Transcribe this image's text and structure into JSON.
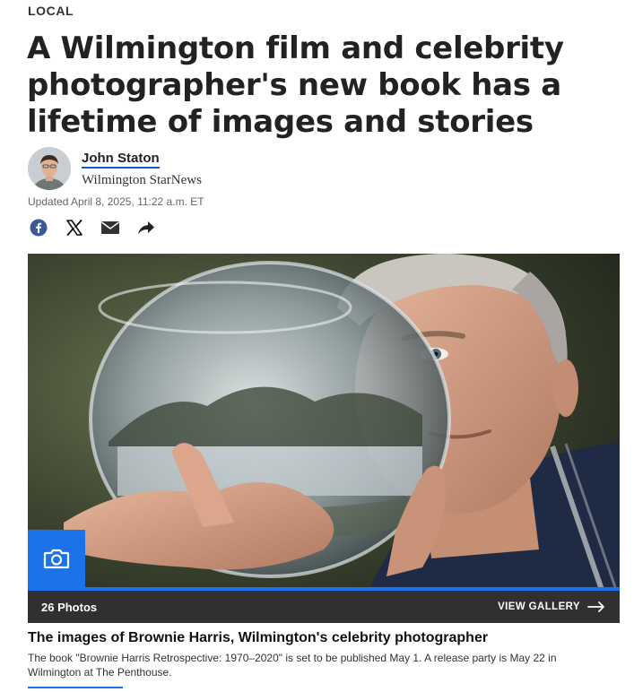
{
  "section": {
    "label": "LOCAL"
  },
  "article": {
    "headline": "A Wilmington film and celebrity photographer's new book has a lifetime of images and stories",
    "author_name": "John Staton",
    "publication": "Wilmington StarNews",
    "updated": "Updated April 8, 2025, 11:22 a.m. ET"
  },
  "share": {
    "icons": [
      "facebook-icon",
      "x-icon",
      "email-icon",
      "share-arrow-icon"
    ]
  },
  "gallery": {
    "photo_count": "26 Photos",
    "view_label": "VIEW GALLERY"
  },
  "caption": {
    "title": "The images of Brownie Harris, Wilmington's celebrity photographer",
    "text": "The book \"Brownie Harris Retrospective: 1970–2020\" is set to be published May 1. A release party is May 22 in Wilmington at The Penthouse."
  },
  "colors": {
    "accent": "#1a73e8",
    "gallery_bar": "#303030",
    "author_underline": "#0b5fbd"
  }
}
